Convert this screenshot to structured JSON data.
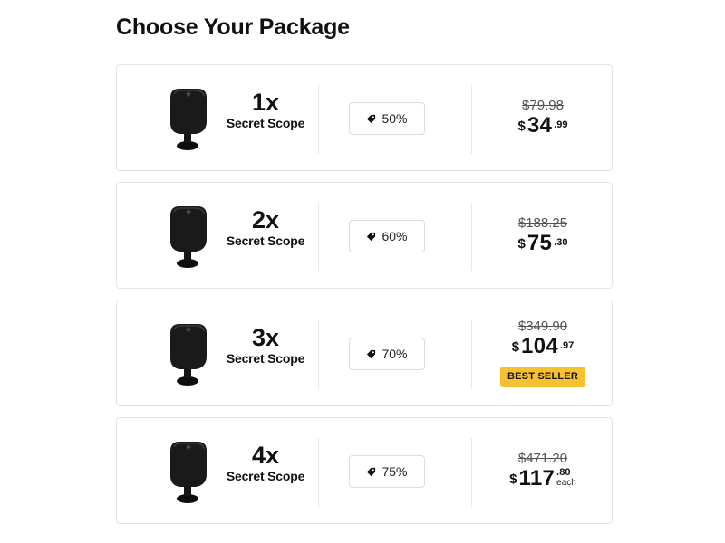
{
  "page": {
    "title": "Choose Your Package"
  },
  "packages": [
    {
      "qty": "1x",
      "name": "Secret Scope",
      "discount": "50%",
      "old_price": "$79.98",
      "currency": "$",
      "dollars": "34",
      "cents": ".99"
    },
    {
      "qty": "2x",
      "name": "Secret Scope",
      "discount": "60%",
      "old_price": "$188.25",
      "currency": "$",
      "dollars": "75",
      "cents": ".30"
    },
    {
      "qty": "3x",
      "name": "Secret Scope",
      "discount": "70%",
      "old_price": "$349.90",
      "currency": "$",
      "dollars": "104",
      "cents": ".97",
      "badge": "BEST SELLER"
    },
    {
      "qty": "4x",
      "name": "Secret Scope",
      "discount": "75%",
      "old_price": "$471.20",
      "currency": "$",
      "dollars": "117",
      "cents": ".80",
      "per": "each"
    }
  ],
  "colors": {
    "badge": "#f6c12e",
    "border": "#e4e4e4",
    "text": "#111111"
  },
  "icons": {
    "discount": "tag-icon",
    "product": "camera-image"
  }
}
